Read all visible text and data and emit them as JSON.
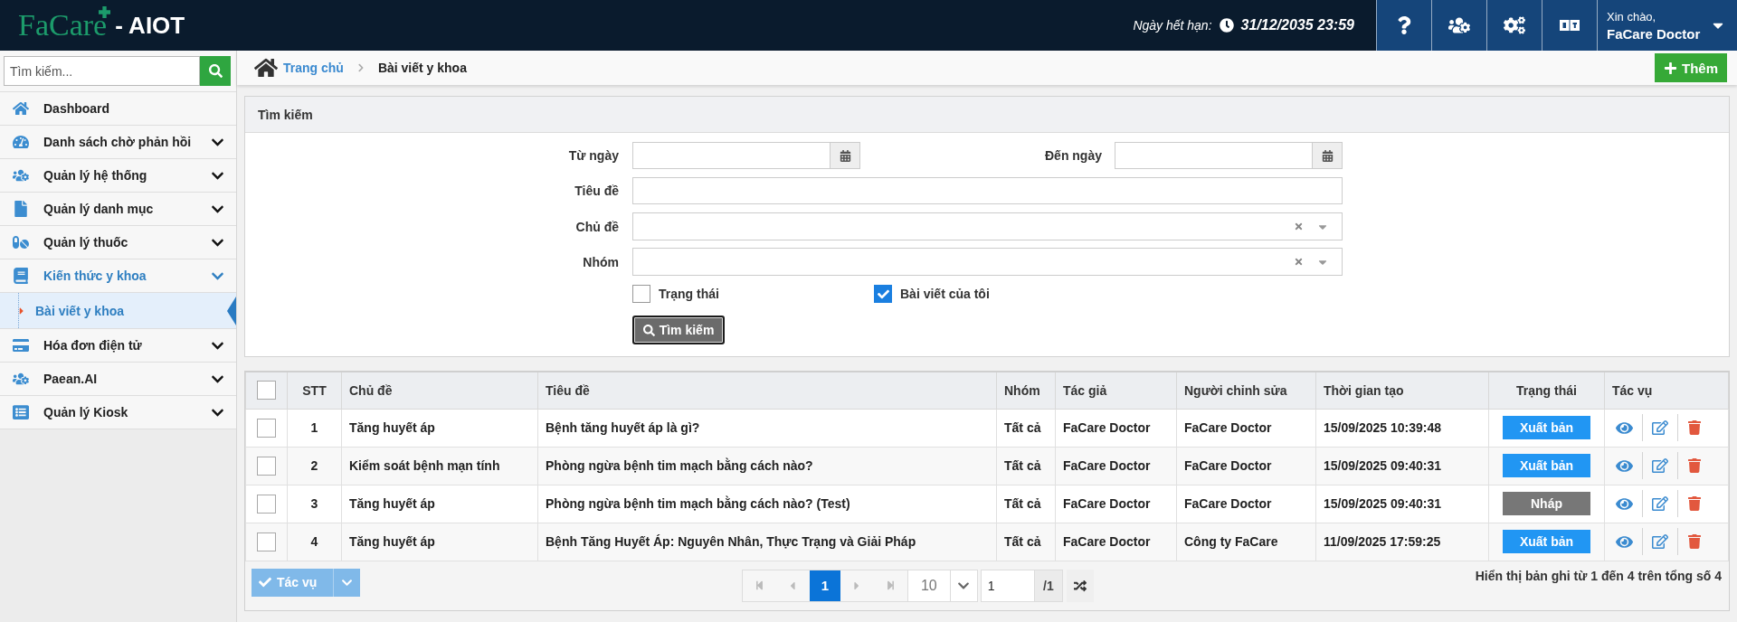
{
  "header": {
    "logo": "FaCare",
    "product": "- AIOT",
    "expiry_label": "Ngày hết hạn:",
    "expiry_value": "31/12/2035 23:59",
    "greeting": "Xin chào,",
    "user_name": "FaCare Doctor"
  },
  "sidebar": {
    "search": {
      "placeholder": "Tìm kiếm..."
    },
    "items": [
      {
        "label": "Dashboard",
        "kind": "link",
        "expanded": false
      },
      {
        "label": "Danh sách chờ phản hồi",
        "kind": "group",
        "expanded": false
      },
      {
        "label": "Quản lý hệ thống",
        "kind": "group",
        "expanded": false
      },
      {
        "label": "Quản lý danh mục",
        "kind": "group",
        "expanded": false
      },
      {
        "label": "Quản lý thuốc",
        "kind": "group",
        "expanded": false
      },
      {
        "label": "Kiến thức y khoa",
        "kind": "group",
        "expanded": true,
        "children": [
          {
            "label": "Bài viết y khoa",
            "selected": true
          }
        ]
      },
      {
        "label": "Hóa đơn điện tử",
        "kind": "group",
        "expanded": false
      },
      {
        "label": "Paean.AI",
        "kind": "group",
        "expanded": false
      },
      {
        "label": "Quản lý Kiosk",
        "kind": "group",
        "expanded": false
      }
    ]
  },
  "breadcrumb": {
    "home": "Trang chủ",
    "current": "Bài viết y khoa"
  },
  "add_button": "Thêm",
  "search_panel": {
    "title": "Tìm kiếm",
    "date_from": {
      "label": "Từ ngày"
    },
    "date_to": {
      "label": "Đến ngày"
    },
    "title_field": {
      "label": "Tiêu đề"
    },
    "selects": [
      {
        "label": "Chủ đề"
      },
      {
        "label": "Nhóm"
      }
    ],
    "checkboxes": [
      {
        "label": "Trạng thái",
        "checked": false
      },
      {
        "label": "Bài viết của tôi",
        "checked": true
      }
    ],
    "submit": "Tìm kiếm"
  },
  "table": {
    "select_all_checked": false,
    "columns": [
      "STT",
      "Chủ đề",
      "Tiêu đề",
      "Nhóm",
      "Tác giả",
      "Người chỉnh sửa",
      "Thời gian tạo",
      "Trạng thái",
      "Tác vụ"
    ],
    "rows": [
      {
        "checked": false,
        "cells": [
          "1",
          "Tăng huyết áp",
          "Bệnh tăng huyết áp là gì?",
          "Tất cả",
          "FaCare Doctor",
          "FaCare Doctor",
          "15/09/2025 10:39:48"
        ],
        "status": {
          "label": "Xuất bản",
          "kind": "published"
        }
      },
      {
        "checked": false,
        "cells": [
          "2",
          "Kiểm soát bệnh mạn tính",
          "Phòng ngừa bệnh tim mạch bằng cách nào?",
          "Tất cả",
          "FaCare Doctor",
          "FaCare Doctor",
          "15/09/2025 09:40:31"
        ],
        "status": {
          "label": "Xuất bản",
          "kind": "published"
        }
      },
      {
        "checked": false,
        "cells": [
          "3",
          "Tăng huyết áp",
          "Phòng ngừa bệnh tim mạch bằng cách nào? (Test)",
          "Tất cả",
          "FaCare Doctor",
          "FaCare Doctor",
          "15/09/2025 09:40:31"
        ],
        "status": {
          "label": "Nháp",
          "kind": "draft"
        }
      },
      {
        "checked": false,
        "cells": [
          "4",
          "Tăng huyết áp",
          "Bệnh Tăng Huyết Áp: Nguyên Nhân, Thực Trạng và Giải Pháp",
          "Tất cả",
          "FaCare Doctor",
          "Công ty FaCare",
          "11/09/2025 17:59:25"
        ],
        "status": {
          "label": "Xuất bản",
          "kind": "published"
        }
      }
    ],
    "footer": {
      "bulk_action": {
        "label": "Tác vụ",
        "disabled": true
      },
      "nav_buttons": [
        {
          "kind": "first",
          "disabled": true
        },
        {
          "kind": "prev",
          "disabled": true
        },
        {
          "kind": "next",
          "disabled": true
        },
        {
          "kind": "last",
          "disabled": true
        }
      ],
      "pages": [
        {
          "label": "1",
          "selected": true
        }
      ],
      "page_size": "10",
      "page_input": "1",
      "page_total": "/1",
      "summary": "Hiển thị bản ghi từ 1 đến 4 trên tổng số 4"
    }
  }
}
